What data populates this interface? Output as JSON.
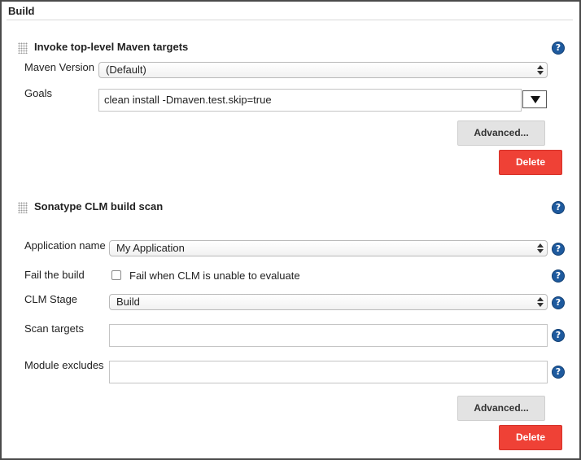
{
  "section": {
    "title": "Build"
  },
  "maven_step": {
    "title": "Invoke top-level Maven targets",
    "maven_version_label": "Maven Version",
    "maven_version_value": "(Default)",
    "goals_label": "Goals",
    "goals_value": "clean install -Dmaven.test.skip=true",
    "advanced_label": "Advanced...",
    "delete_label": "Delete"
  },
  "clm_step": {
    "title": "Sonatype CLM build scan",
    "application_name_label": "Application name",
    "application_name_value": "My Application",
    "fail_build_label": "Fail the build",
    "fail_build_checkbox_label": "Fail when CLM is unable to evaluate",
    "fail_build_checked": false,
    "clm_stage_label": "CLM Stage",
    "clm_stage_value": "Build",
    "scan_targets_label": "Scan targets",
    "scan_targets_value": "",
    "module_excludes_label": "Module excludes",
    "module_excludes_value": "",
    "advanced_label": "Advanced...",
    "delete_label": "Delete"
  },
  "icons": {
    "help": "?"
  },
  "colors": {
    "help_blue": "#1e5a9e",
    "delete_red": "#ef4136",
    "advanced_gray": "#e3e3e3"
  }
}
